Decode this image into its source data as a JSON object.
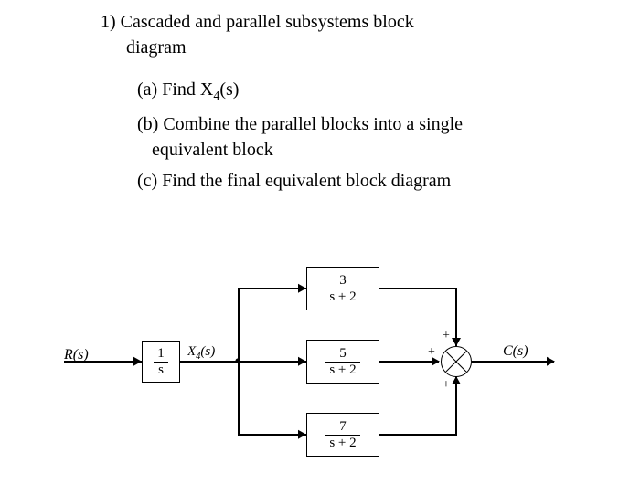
{
  "question": {
    "number": "1)",
    "title_line1": "Cascaded and parallel subsystems block",
    "title_line2": "diagram",
    "parts": {
      "a_prefix": "(a)",
      "a_text_before": " Find X",
      "a_sub": "4",
      "a_text_after": "(s)",
      "b_prefix": "(b)",
      "b_text_line1": " Combine the parallel blocks into a single",
      "b_text_line2": "equivalent block",
      "c_prefix": "(c)",
      "c_text": " Find the final equivalent block diagram"
    }
  },
  "diagram": {
    "input_label": "R(s)",
    "output_label": "C(s)",
    "mid_label_before": "X",
    "mid_label_sub": "4",
    "mid_label_after": "(s)",
    "block1": {
      "num": "1",
      "den": "s"
    },
    "block_top": {
      "num": "3",
      "den": "s + 2"
    },
    "block_mid": {
      "num": "5",
      "den": "s + 2"
    },
    "block_bot": {
      "num": "7",
      "den": "s + 2"
    },
    "sum_signs": {
      "top": "+",
      "mid": "+",
      "bot": "+"
    }
  },
  "chart_data": {
    "type": "block_diagram",
    "input": "R(s)",
    "output": "C(s)",
    "cascade": [
      {
        "name": "G0",
        "tf_num": "1",
        "tf_den": "s",
        "output_signal": "X4(s)"
      }
    ],
    "parallel_branches": [
      {
        "name": "G1",
        "tf_num": "3",
        "tf_den": "s+2",
        "sign": "+"
      },
      {
        "name": "G2",
        "tf_num": "5",
        "tf_den": "s+2",
        "sign": "+"
      },
      {
        "name": "G3",
        "tf_num": "7",
        "tf_den": "s+2",
        "sign": "+"
      }
    ],
    "summing_junction": "adds all parallel branch outputs to produce C(s)"
  }
}
